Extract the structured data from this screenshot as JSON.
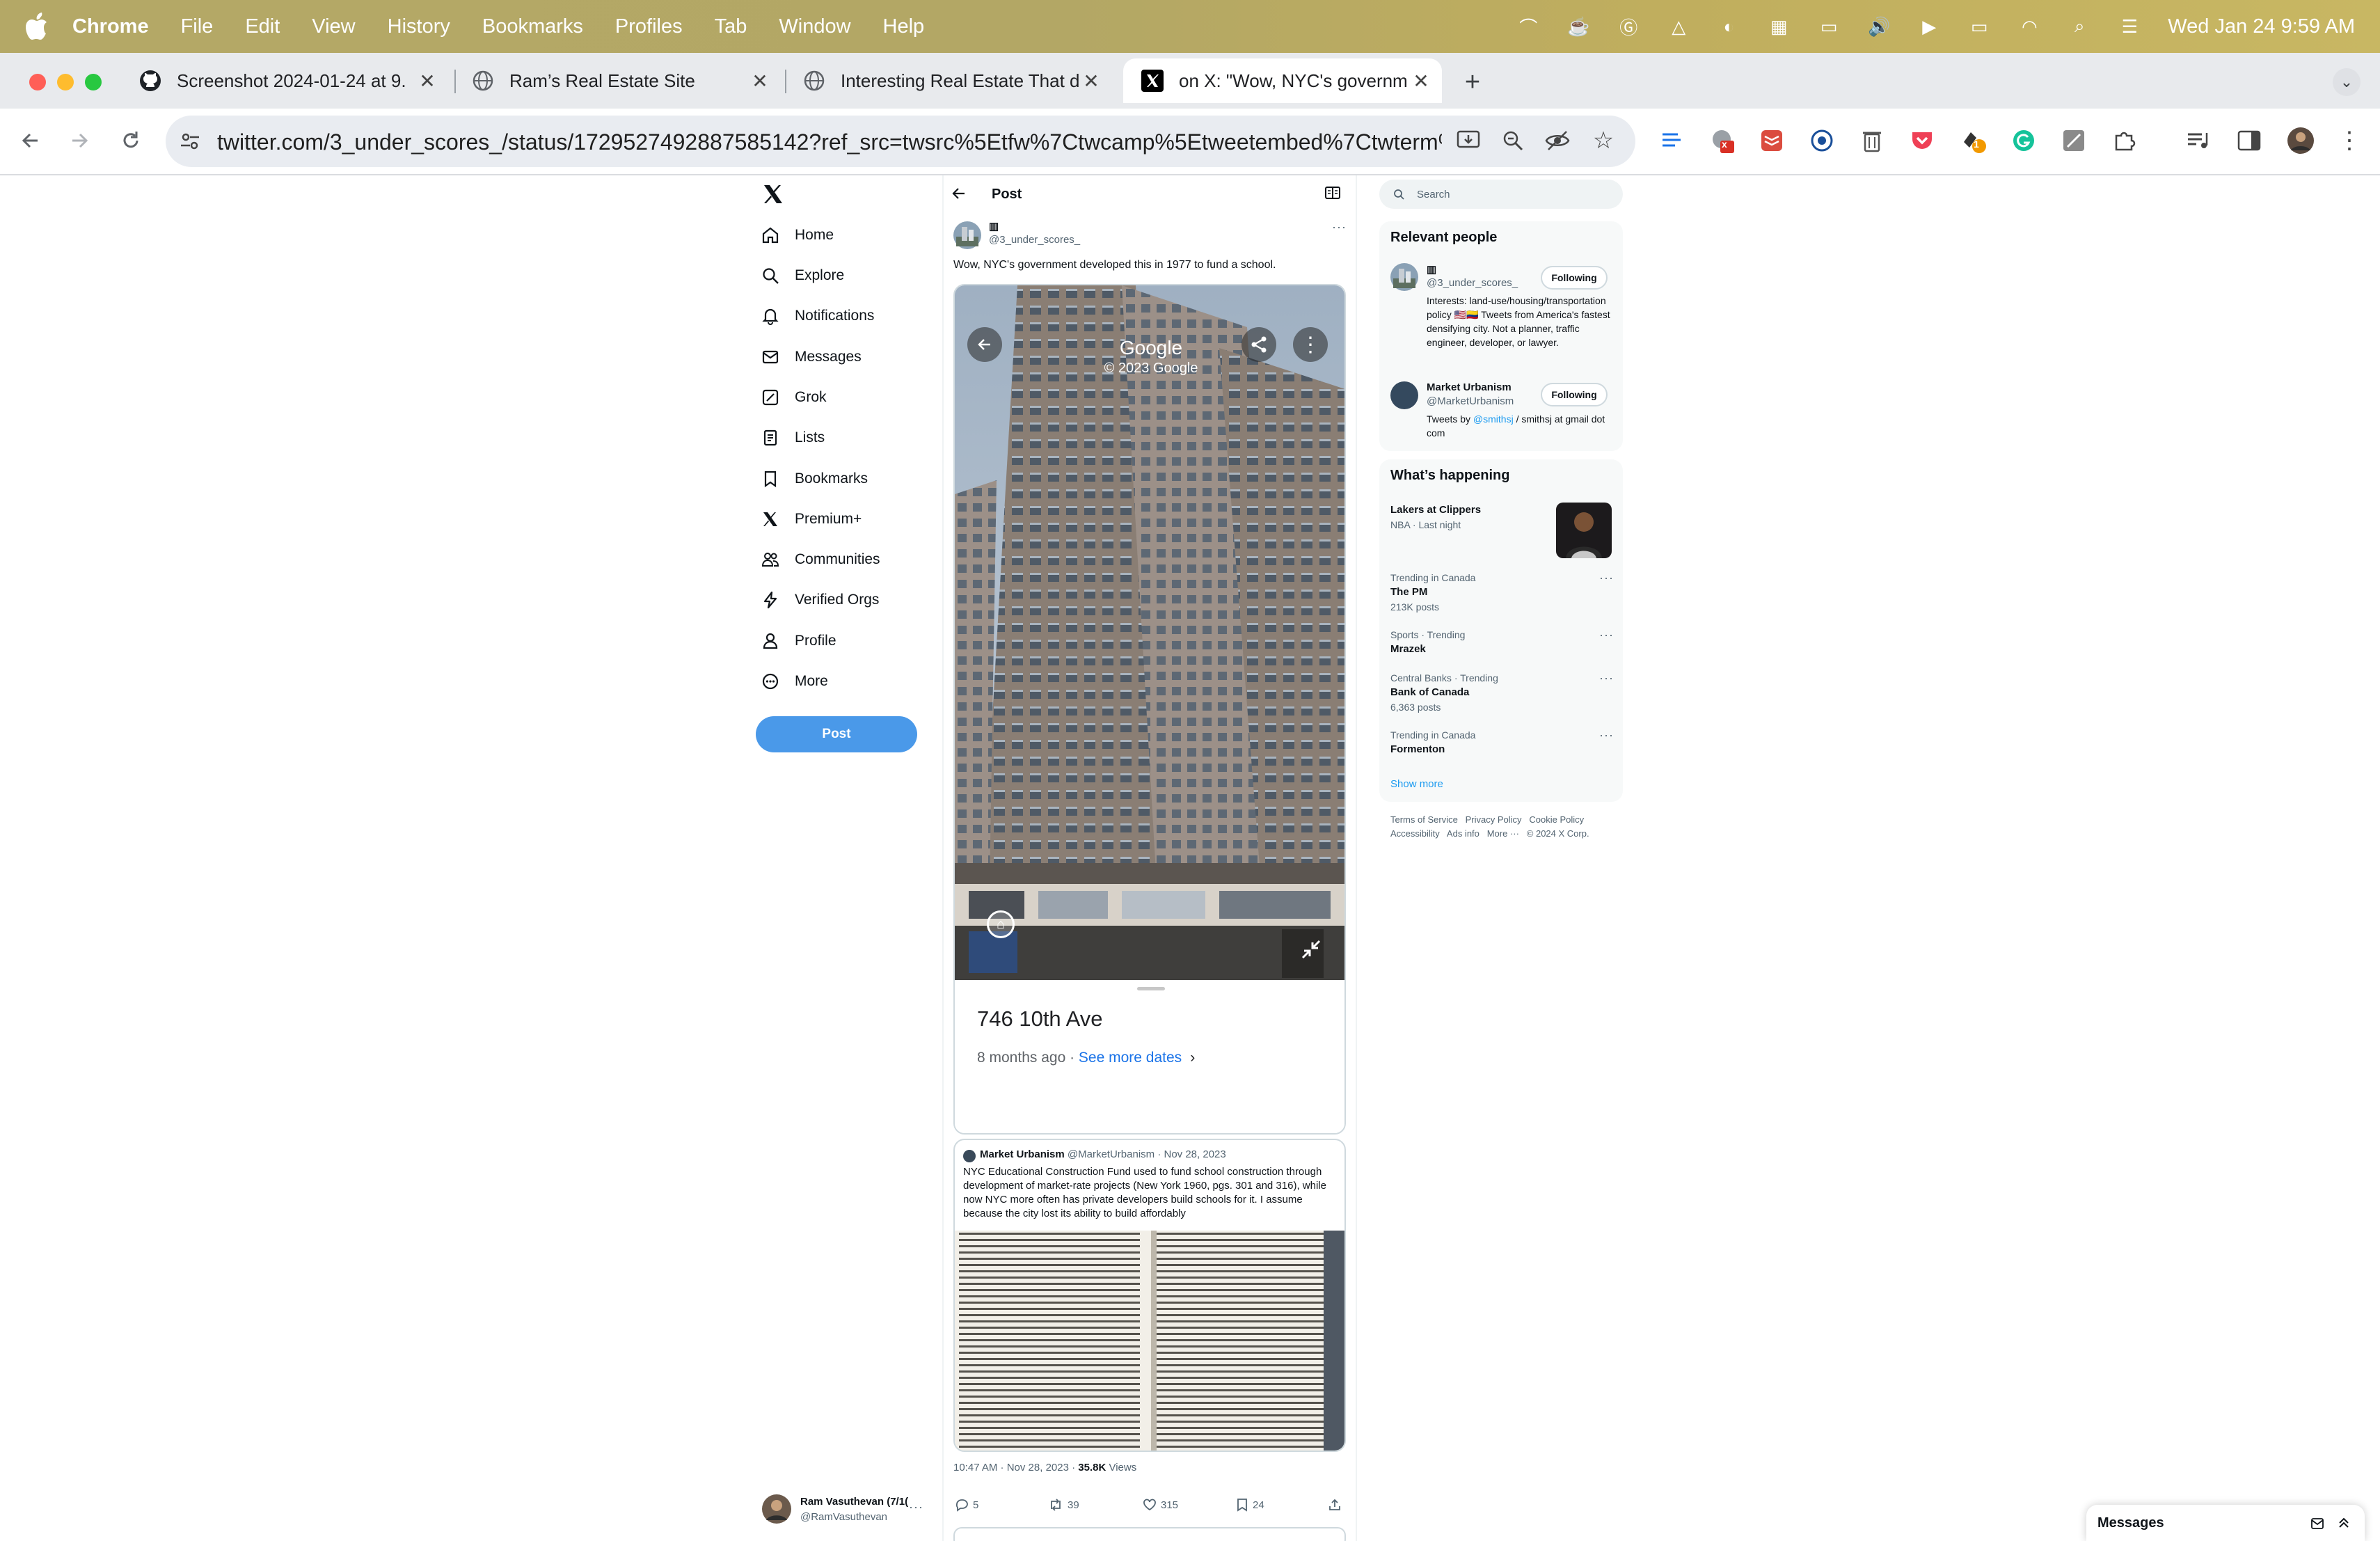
{
  "menubar": {
    "app_name": "Chrome",
    "items": [
      "File",
      "Edit",
      "View",
      "History",
      "Bookmarks",
      "Profiles",
      "Tab",
      "Window",
      "Help"
    ],
    "clock": "Wed Jan 24  9:59 AM"
  },
  "tabs": [
    {
      "title": "Screenshot 2024-01-24 at 9.",
      "icon": "github-icon"
    },
    {
      "title": "Ram’s Real Estate Site",
      "icon": "globe-icon"
    },
    {
      "title": "Interesting Real Estate That d",
      "icon": "globe-icon"
    },
    {
      "title": "on X: \"Wow, NYC's governm",
      "icon": "x-logo-icon"
    }
  ],
  "toolbar": {
    "url": "twitter.com/3_under_scores_/status/1729527492887585142?ref_src=twsrc%5Etfw%7Ctwcamp%5Etweetembed%7Ctwterm%5E17...",
    "ext_badge_1": "x",
    "ext_badge_2": "1"
  },
  "x_nav": {
    "items": [
      "Home",
      "Explore",
      "Notifications",
      "Messages",
      "Grok",
      "Lists",
      "Bookmarks",
      "Premium+",
      "Communities",
      "Verified Orgs",
      "Profile",
      "More"
    ],
    "post_button": "Post",
    "account": {
      "name": "Ram Vasuthevan (7/1(",
      "handle": "@RamVasuthevan"
    }
  },
  "post": {
    "header": "Post",
    "author_name": "▥",
    "author_handle": "@3_under_scores_",
    "text": "Wow, NYC's government developed this in 1977 to fund a school.",
    "streetview": {
      "brand": "Google",
      "copyright": "© 2023 Google",
      "address": "746 10th Ave",
      "date_text": "8 months ago · ",
      "more_dates": "See more dates"
    },
    "quote": {
      "name": "Market Urbanism",
      "handle": "@MarketUrbanism",
      "sep": " · ",
      "date": "Nov 28, 2023",
      "text": "NYC Educational Construction Fund used to fund school construction through development of market-rate projects (New York 1960, pgs. 301 and 316), while now NYC more often has private developers build schools for it. I assume because the city lost its ability to build affordably"
    },
    "meta": {
      "time": "10:47 AM · Nov 28, 2023 · ",
      "views_count": "35.8K",
      "views_label": " Views"
    },
    "stats": {
      "replies": "5",
      "reposts": "39",
      "likes": "315",
      "bookmarks": "24"
    }
  },
  "right": {
    "search_placeholder": "Search",
    "relevant_title": "Relevant people",
    "people": [
      {
        "name": "▥",
        "handle": "@3_under_scores_",
        "button": "Following",
        "bio": "Interests: land-use/housing/transportation policy 🇺🇸🇨🇴 Tweets from America's fastest densifying city. Not a planner, traffic engineer, developer, or lawyer."
      },
      {
        "name": "Market Urbanism",
        "handle": "@MarketUrbanism",
        "button": "Following",
        "bio_pre": "Tweets by ",
        "bio_link": "@smithsj",
        "bio_post": " / smithsj at gmail dot com"
      }
    ],
    "happening_title": "What’s happening",
    "trends": [
      {
        "meta": "NBA · Last night",
        "title": "Lakers at Clippers",
        "count": ""
      },
      {
        "meta": "Trending in Canada",
        "title": "The PM",
        "count": "213K posts"
      },
      {
        "meta": "Sports · Trending",
        "title": "Mrazek",
        "count": ""
      },
      {
        "meta": "Central Banks · Trending",
        "title": "Bank of Canada",
        "count": "6,363 posts"
      },
      {
        "meta": "Trending in Canada",
        "title": "Formenton",
        "count": ""
      }
    ],
    "show_more": "Show more",
    "footer_line1": "Terms of Service   Privacy Policy   Cookie Policy",
    "footer_line2": "Accessibility   Ads info   More ···   © 2024 X Corp."
  },
  "messages_drawer": {
    "title": "Messages"
  },
  "colors": {
    "accent": "#1d9bf0",
    "post_button": "#4a99e9"
  }
}
